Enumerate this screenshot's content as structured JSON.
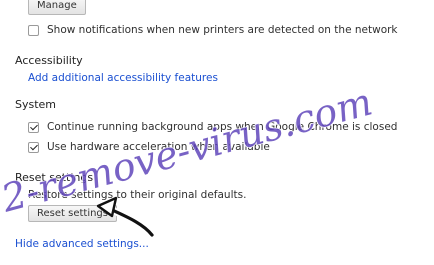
{
  "top": {
    "manage_label": "Manage"
  },
  "printers": {
    "notify_label": "Show notifications when new printers are detected on the network",
    "checked": false
  },
  "accessibility": {
    "heading": "Accessibility",
    "link": "Add additional accessibility features"
  },
  "system": {
    "heading": "System",
    "items": [
      {
        "label": "Continue running background apps when Google Chrome is closed",
        "checked": true
      },
      {
        "label": "Use hardware acceleration when available",
        "checked": true
      }
    ]
  },
  "reset": {
    "heading": "Reset settings",
    "description": "Restore settings to their original defaults.",
    "button_label": "Reset settings"
  },
  "footer": {
    "advanced_link": "Hide advanced settings..."
  },
  "watermark": {
    "text": "2-remove-virus.com",
    "color": "#5a3fb8"
  },
  "icons": {
    "arrow": "cursor-arrow-icon"
  }
}
